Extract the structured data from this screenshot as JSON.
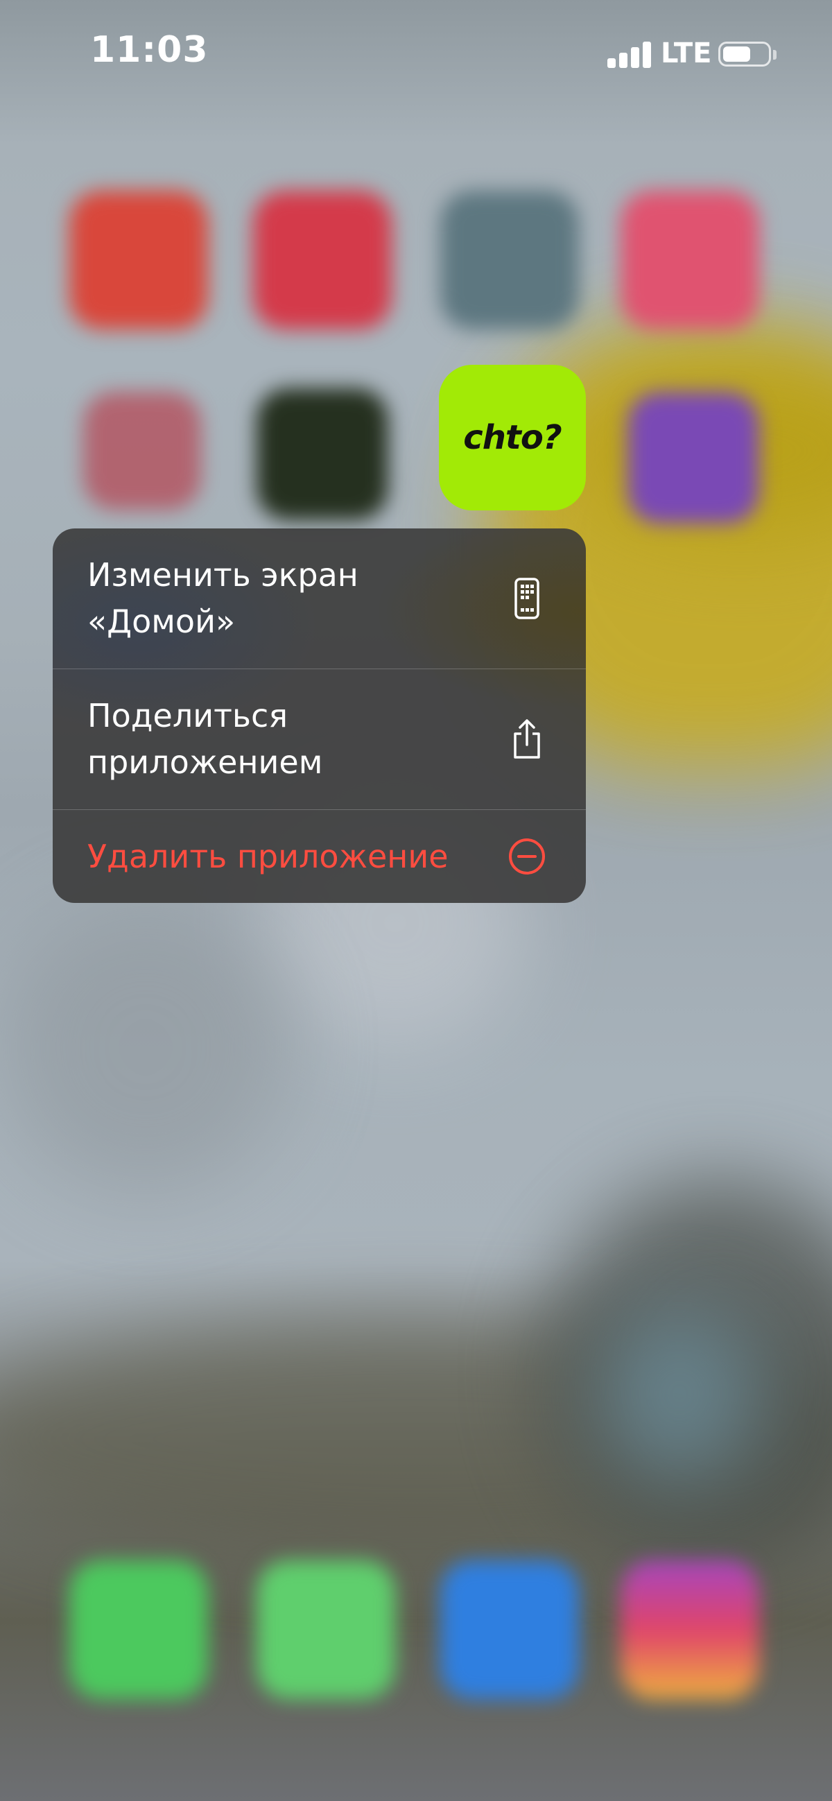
{
  "status_bar": {
    "time": "11:03",
    "network": "LTE",
    "battery_level": 0.55
  },
  "focused_app": {
    "label": "chto?",
    "background_color": "#a2ea06"
  },
  "context_menu": {
    "items": [
      {
        "label": "Изменить экран «Домой»",
        "icon": "home-screen-phone-icon",
        "color": "#ffffff"
      },
      {
        "label": "Поделиться приложением",
        "icon": "share-icon",
        "color": "#ffffff"
      },
      {
        "label": "Удалить приложение",
        "icon": "remove-minus-circle-icon",
        "color": "#ff4d40"
      }
    ]
  },
  "blurred_apps": [
    {
      "icon": "blurred-app-icon",
      "color": "#d9473b"
    },
    {
      "icon": "blurred-app-icon",
      "color": "#d43a4a"
    },
    {
      "icon": "blurred-app-icon",
      "color": "#5d7780"
    },
    {
      "icon": "blurred-app-icon",
      "color": "#e05370"
    },
    {
      "icon": "blurred-app-icon",
      "color": "#b54a57"
    },
    {
      "icon": "blurred-app-icon",
      "color": "#25301f"
    },
    {
      "icon": "blurred-app-icon",
      "color": "#7a49b5"
    },
    {
      "icon": "phone-icon",
      "color": "#4cc95e"
    },
    {
      "icon": "messages-icon",
      "color": "#5fcf6d"
    },
    {
      "icon": "blurred-app-icon",
      "color": "#2f7fe0"
    },
    {
      "icon": "instagram-icon",
      "color": "#c23fa0"
    }
  ]
}
